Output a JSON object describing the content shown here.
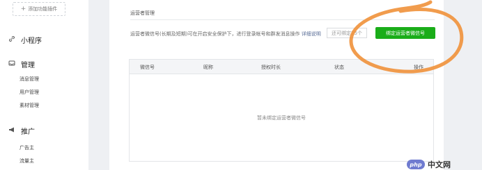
{
  "sidebar": {
    "add_feature": "添加功能插件",
    "sections": [
      {
        "label": "小程序",
        "icon": "link-icon"
      },
      {
        "label": "管理",
        "icon": "inbox-icon",
        "items": [
          "消息管理",
          "用户管理",
          "素材管理"
        ]
      },
      {
        "label": "推广",
        "icon": "megaphone-icon",
        "items": [
          "广告主",
          "流量主"
        ]
      }
    ]
  },
  "main": {
    "card_title": "运营者管理",
    "description": "运营者微信号(长期及短期)可在开启安全保护下，进行登录帐号和群发消息操作",
    "detail_link": "详细说明",
    "count_text": "还可绑定25个",
    "bind_button": "绑定运营者微信号",
    "table": {
      "headers": [
        "微信号",
        "昵称",
        "授权时长",
        "状态",
        "操作"
      ],
      "empty_text": "暂未绑定运营者微信号"
    }
  },
  "watermark": {
    "logo": "php",
    "text": "中文网"
  },
  "colors": {
    "accent": "#1aad19",
    "annotation": "#f0913a"
  }
}
